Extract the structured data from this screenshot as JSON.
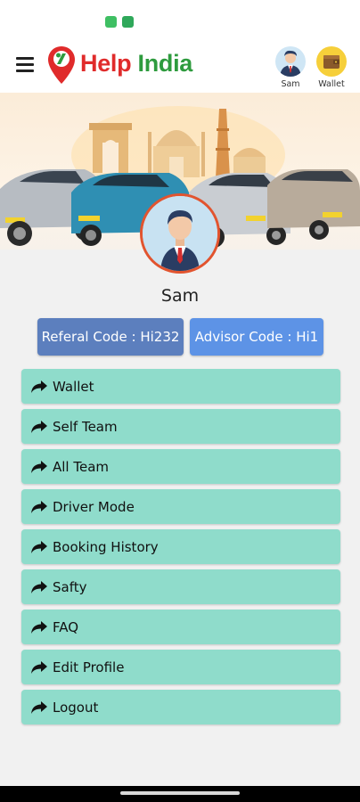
{
  "app": {
    "brand_part1": "Help",
    "brand_part2": " India"
  },
  "header": {
    "user_label": "Sam",
    "wallet_label": "Wallet"
  },
  "profile": {
    "name": "Sam",
    "referral_code": "Referal Code : Hi232",
    "advisor_code": "Advisor Code : Hi1"
  },
  "menu": {
    "items": [
      {
        "label": "Wallet"
      },
      {
        "label": "Self Team"
      },
      {
        "label": "All Team"
      },
      {
        "label": "Driver Mode"
      },
      {
        "label": "Booking History"
      },
      {
        "label": "Safty"
      },
      {
        "label": "FAQ"
      },
      {
        "label": "Edit Profile"
      },
      {
        "label": "Logout"
      }
    ]
  },
  "colors": {
    "brand_red": "#e02b2b",
    "brand_green": "#2e9b3e",
    "menu_item_bg": "#8fdccb",
    "referral_btn": "#5c7fbe",
    "advisor_btn": "#5d93e6",
    "avatar_border": "#e2542f"
  },
  "icons": {
    "menu": "hamburger-icon",
    "logo": "location-pin-icon",
    "user": "user-avatar-icon",
    "wallet": "wallet-icon",
    "item_arrow": "share-arrow-icon"
  }
}
